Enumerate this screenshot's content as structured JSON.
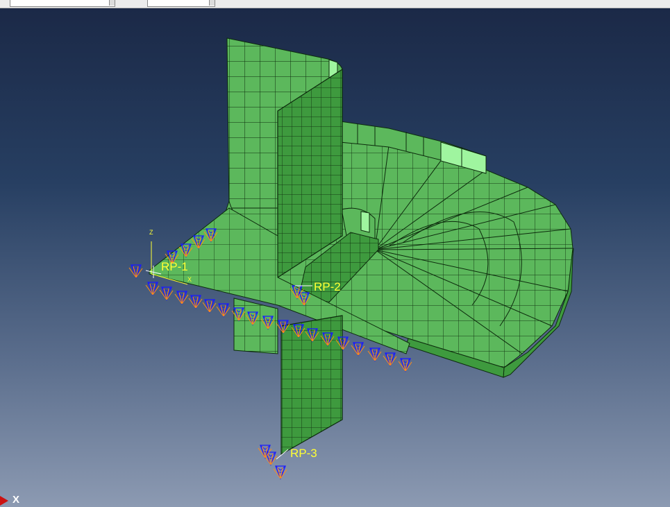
{
  "toolbar": {
    "combo1_value": "",
    "combo2_value": ""
  },
  "viewport": {
    "reference_points": [
      "RP-1",
      "RP-2",
      "RP-3"
    ],
    "csys_labels": {
      "z": "Z",
      "x": "X"
    },
    "triad_labels": {
      "x": "X"
    }
  },
  "colors": {
    "mesh_face": "#5cb85c",
    "mesh_face_dark": "#3e9a3e",
    "mesh_highlight": "#9ff59f",
    "mesh_edge": "#0c2a0c",
    "bc_marker": "#1a1aff",
    "bc_tip": "#ff8a1a",
    "rp_label": "#ffff33"
  }
}
